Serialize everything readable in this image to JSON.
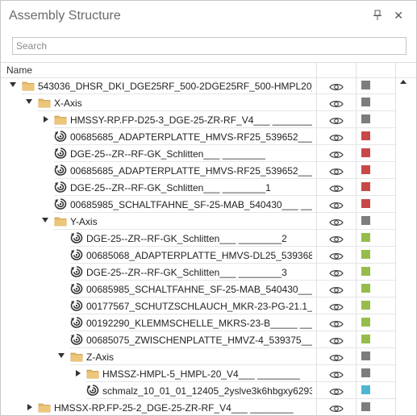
{
  "panel": {
    "title": "Assembly Structure",
    "pin_icon": "pin-icon",
    "close_label": "✕"
  },
  "search": {
    "placeholder": "Search",
    "value": ""
  },
  "columns": {
    "name": "Name"
  },
  "colors": {
    "gray": "#7d7d7d",
    "red": "#c84848",
    "green": "#96bd4b",
    "blue": "#4eb6d2"
  },
  "rows": [
    {
      "label": "543036_DHSR_DKI_DGE25RF_500-2DGE25RF_500-HMPL20_200",
      "type": "folder",
      "level": 0,
      "expander": "open",
      "color": "gray"
    },
    {
      "label": "X-Axis",
      "type": "folder",
      "level": 1,
      "expander": "open",
      "color": "gray"
    },
    {
      "label": "HMSSY-RP.FP-D25-3_DGE-25-ZR-RF_V4___ ________",
      "type": "folder",
      "level": 2,
      "expander": "closed",
      "color": "gray"
    },
    {
      "label": "00685685_ADAPTERPLATTE_HMVS-RF25_539652___ __...",
      "type": "part",
      "level": 2,
      "expander": "none",
      "color": "red"
    },
    {
      "label": "DGE-25--ZR--RF-GK_Schlitten___ ________",
      "type": "part",
      "level": 2,
      "expander": "none",
      "color": "red"
    },
    {
      "label": "00685685_ADAPTERPLATTE_HMVS-RF25_539652___ __...",
      "type": "part",
      "level": 2,
      "expander": "none",
      "color": "red"
    },
    {
      "label": "DGE-25--ZR--RF-GK_Schlitten___ ________1",
      "type": "part",
      "level": 2,
      "expander": "none",
      "color": "red"
    },
    {
      "label": "00685985_SCHALTFAHNE_SF-25-MAB_540430___ ___...",
      "type": "part",
      "level": 2,
      "expander": "none",
      "color": "red"
    },
    {
      "label": "Y-Axis",
      "type": "folder",
      "level": 2,
      "expander": "open",
      "color": "gray"
    },
    {
      "label": "DGE-25--ZR--RF-GK_Schlitten___ ________2",
      "type": "part",
      "level": 3,
      "expander": "none",
      "color": "green"
    },
    {
      "label": "00685068_ADAPTERPLATTE_HMVS-DL25_539368___...",
      "type": "part",
      "level": 3,
      "expander": "none",
      "color": "green"
    },
    {
      "label": "DGE-25--ZR--RF-GK_Schlitten___ ________3",
      "type": "part",
      "level": 3,
      "expander": "none",
      "color": "green"
    },
    {
      "label": "00685985_SCHALTFAHNE_SF-25-MAB_540430___ ___...",
      "type": "part",
      "level": 3,
      "expander": "none",
      "color": "green"
    },
    {
      "label": "00177567_SCHUTZSCHLAUCH_MKR-23-PG-21.1___ ...",
      "type": "part",
      "level": 3,
      "expander": "none",
      "color": "green"
    },
    {
      "label": "00192290_KLEMMSCHELLE_MKRS-23-B_____ ____...",
      "type": "part",
      "level": 3,
      "expander": "none",
      "color": "green"
    },
    {
      "label": "00685075_ZWISCHENPLATTE_HMVZ-4_539375___ ___...",
      "type": "part",
      "level": 3,
      "expander": "none",
      "color": "green"
    },
    {
      "label": "Z-Axis",
      "type": "folder",
      "level": 3,
      "expander": "open",
      "color": "gray"
    },
    {
      "label": "HMSSZ-HMPL-5_HMPL-20_V4___ ________",
      "type": "folder",
      "level": 4,
      "expander": "closed",
      "color": "gray"
    },
    {
      "label": "schmalz_10_01_01_12405_2yslve3k6hbgxy6293...",
      "type": "part",
      "level": 4,
      "expander": "none",
      "color": "blue"
    },
    {
      "label": "HMSSX-RP.FP-25-2_DGE-25-ZR-RF_V4___ ________",
      "type": "folder",
      "level": 1,
      "expander": "closed",
      "color": "gray"
    }
  ]
}
